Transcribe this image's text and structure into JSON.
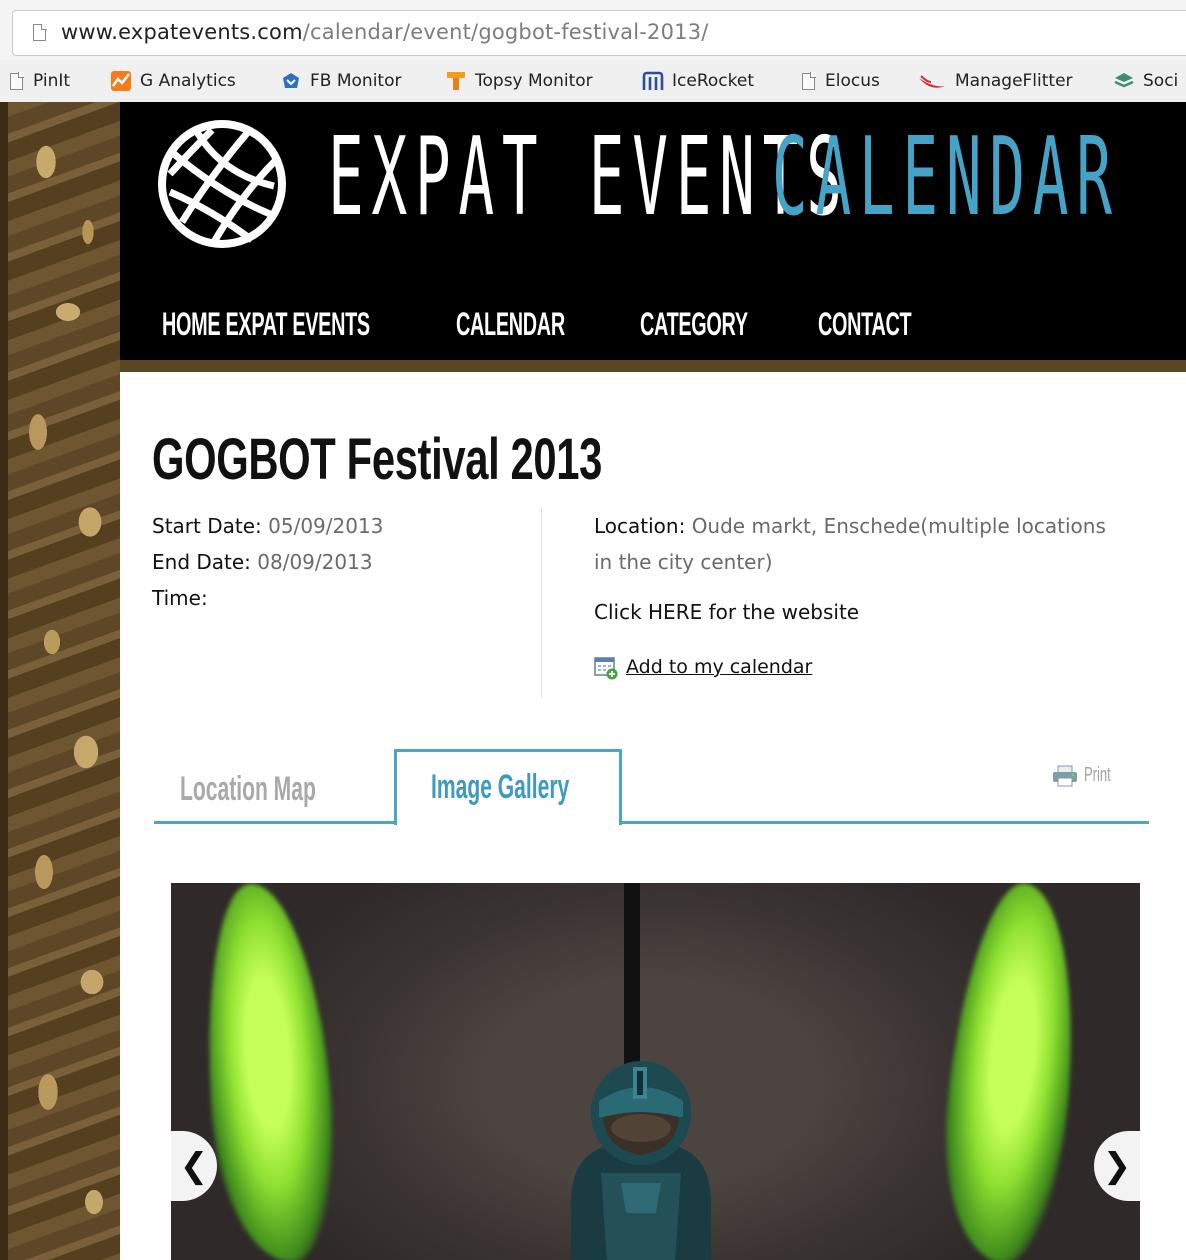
{
  "browser": {
    "url_host": "www.expatevents.com",
    "url_path": "/calendar/event/gogbot-festival-2013/",
    "bookmarks": [
      {
        "label": "PinIt",
        "icon": "page-icon"
      },
      {
        "label": "G Analytics",
        "icon": "analytics-icon"
      },
      {
        "label": "FB Monitor",
        "icon": "fb-monitor-icon"
      },
      {
        "label": "Topsy Monitor",
        "icon": "topsy-icon"
      },
      {
        "label": "IceRocket",
        "icon": "icerocket-icon"
      },
      {
        "label": "Elocus",
        "icon": "page-icon"
      },
      {
        "label": "ManageFlitter",
        "icon": "manageflitter-icon"
      },
      {
        "label": "Soci",
        "icon": "stack-icon"
      }
    ]
  },
  "site": {
    "logo_primary": "EXPAT EVENTS",
    "logo_secondary": "CALENDAR",
    "accent_color": "#45a3c8",
    "nav": [
      "HOME EXPAT EVENTS",
      "CALENDAR",
      "CATEGORY",
      "CONTACT"
    ]
  },
  "event": {
    "title": "GOGBOT Festival 2013",
    "start_label": "Start Date:",
    "start_value": "05/09/2013",
    "end_label": "End Date:",
    "end_value": "08/09/2013",
    "time_label": "Time:",
    "location_label": "Location:",
    "location_value": "Oude markt, Enschede(multiple locations in the city center)",
    "website_text": "Click HERE for the website",
    "add_calendar": "Add to my calendar"
  },
  "tabs": {
    "location_map": "Location Map",
    "image_gallery": "Image Gallery",
    "active": "Image Gallery",
    "print": "Print"
  },
  "gallery": {
    "prev_icon": "chevron-left-icon",
    "next_icon": "chevron-right-icon"
  }
}
